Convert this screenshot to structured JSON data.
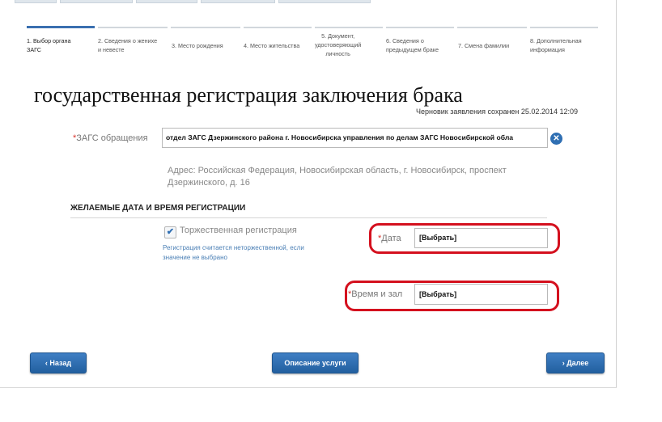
{
  "steps": [
    {
      "line1": "1. Выбор органа",
      "line2": "ЗАГС",
      "line3": ""
    },
    {
      "line1": "2. Сведения о женихе",
      "line2": "и невесте",
      "line3": ""
    },
    {
      "line1": "3. Место рождения",
      "line2": "",
      "line3": ""
    },
    {
      "line1": "4. Место жительства",
      "line2": "",
      "line3": ""
    },
    {
      "line1": "5. Документ,",
      "line2": "удостоверяющий",
      "line3": "личность"
    },
    {
      "line1": "6. Сведения о",
      "line2": "предыдущем браке",
      "line3": ""
    },
    {
      "line1": "7. Смена фамилии",
      "line2": "",
      "line3": ""
    },
    {
      "line1": "8. Дополнительная",
      "line2": "информация",
      "line3": ""
    }
  ],
  "page": {
    "title": "государственная регистрация заключения брака",
    "saved": "Черновик заявления сохранен 25.02.2014 12:09"
  },
  "zags": {
    "required_mark": "*",
    "label": "ЗАГС обращения",
    "value": "отдел ЗАГС Дзержинского района г. Новосибирска управления по делам ЗАГС Новосибирской обла",
    "clear_icon": "✕",
    "address": "Адрес: Российская Федерация, Новосибирская область, г. Новосибирск, проспект Дзержинского, д. 16"
  },
  "section": {
    "heading": "ЖЕЛАЕМЫЕ ДАТА И ВРЕМЯ РЕГИСТРАЦИИ",
    "checkbox_mark": "✔",
    "checkbox_label": "Торжественная регистрация",
    "hint": "Регистрация считается неторжественной, если значение не выбрано",
    "date_required": "*",
    "date_label": "Дата",
    "date_value": "[Выбрать]",
    "time_required": "*",
    "time_label": "Время и зал",
    "time_value": "[Выбрать]"
  },
  "buttons": {
    "back": "‹  Назад",
    "service": "Описание услуги",
    "next": "›  Далее"
  },
  "colors": {
    "accent": "#2f6fb3",
    "highlight": "#d4101e",
    "required": "#d9342b"
  }
}
